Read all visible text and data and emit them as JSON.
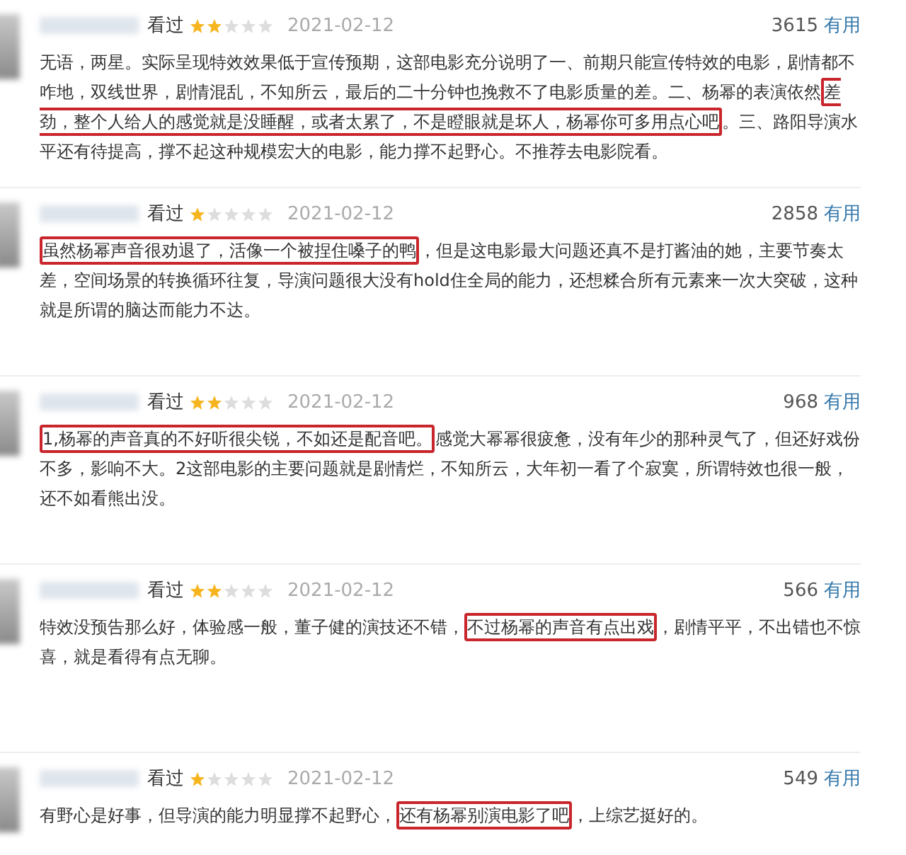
{
  "reviews": [
    {
      "status": "看过",
      "stars": 2,
      "date": "2021-02-12",
      "votes": "3615",
      "vote_label": "有用",
      "segments": [
        {
          "text": "无语，两星。实际呈现特效效果低于宣传预期，这部电影充分说明了一、前期只能宣传特效的电影，剧情都不咋地，双线世界，剧情混乱，不知所云，最后的二十分钟也挽救不了电影质量的差。二、杨幂的表演依然",
          "highlighted": false
        },
        {
          "text": "差劲，整个人给人的感觉就是没睡醒，或者太累了，不是瞪眼就是坏人，杨幂你可多用点心吧",
          "highlighted": true
        },
        {
          "text": "。三、路阳导演水平还有待提高，撑不起这种规模宏大的电影，能力撑不起野心。不推荐去电影院看。",
          "highlighted": false
        }
      ]
    },
    {
      "status": "看过",
      "stars": 1,
      "date": "2021-02-12",
      "votes": "2858",
      "vote_label": "有用",
      "segments": [
        {
          "text": "虽然杨幂声音很劝退了，活像一个被捏住嗓子的鸭",
          "highlighted": true
        },
        {
          "text": "，但是这电影最大问题还真不是打酱油的她，主要节奏太差，空间场景的转换循环往复，导演问题很大没有hold住全局的能力，还想糅合所有元素来一次大突破，这种就是所谓的脑达而能力不达。",
          "highlighted": false
        }
      ]
    },
    {
      "status": "看过",
      "stars": 2,
      "date": "2021-02-12",
      "votes": "968",
      "vote_label": "有用",
      "segments": [
        {
          "text": "1,杨幂的声音真的不好听很尖锐，不如还是配音吧。",
          "highlighted": true
        },
        {
          "text": "感觉大幂幂很疲惫，没有年少的那种灵气了，但还好戏份不多，影响不大。2这部电影的主要问题就是剧情烂，不知所云，大年初一看了个寂寞，所谓特效也很一般，还不如看熊出没。",
          "highlighted": false
        }
      ]
    },
    {
      "status": "看过",
      "stars": 2,
      "date": "2021-02-12",
      "votes": "566",
      "vote_label": "有用",
      "segments": [
        {
          "text": "特效没预告那么好，体验感一般，董子健的演技还不错，",
          "highlighted": false
        },
        {
          "text": "不过杨幂的声音有点出戏",
          "highlighted": true
        },
        {
          "text": "，剧情平平，不出错也不惊喜，就是看得有点无聊。",
          "highlighted": false
        }
      ]
    },
    {
      "status": "看过",
      "stars": 1,
      "date": "2021-02-12",
      "votes": "549",
      "vote_label": "有用",
      "segments": [
        {
          "text": "有野心是好事，但导演的能力明显撑不起野心，",
          "highlighted": false
        },
        {
          "text": "还有杨幂别演电影了吧",
          "highlighted": true
        },
        {
          "text": "，上综艺挺好的。",
          "highlighted": false
        }
      ]
    }
  ]
}
